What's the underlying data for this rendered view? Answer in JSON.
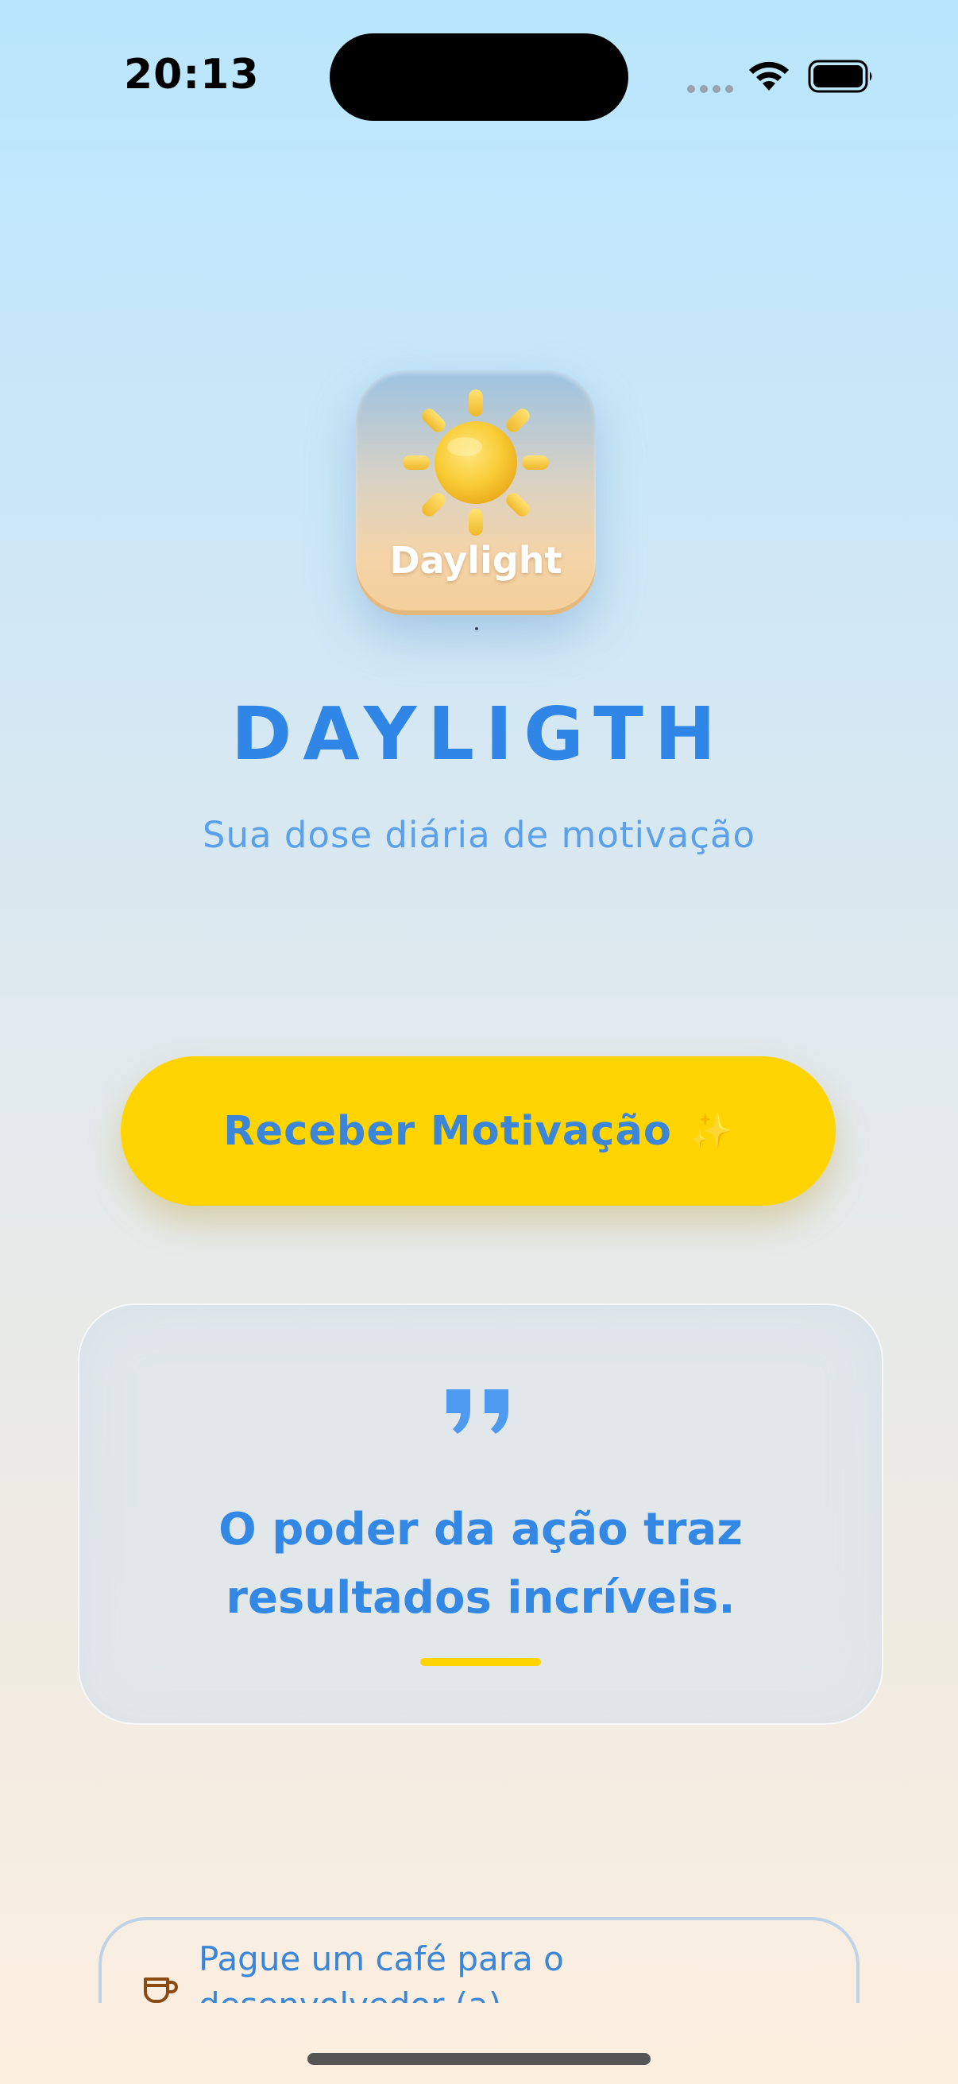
{
  "status_bar": {
    "time": "20:13",
    "icons": [
      "cellular-signal-icon",
      "wifi-icon",
      "battery-icon"
    ]
  },
  "app_icon": {
    "label": "Daylight",
    "icon": "sun-icon"
  },
  "header": {
    "title": "DAYLIGTH",
    "tagline": "Sua dose diária de motivação"
  },
  "motivation_button": {
    "label": "Receber Motivação",
    "emoji": "✨"
  },
  "quote_card": {
    "icon": "quote-icon",
    "text": "O poder da ação traz resultados incríveis."
  },
  "donate": {
    "icon": "coffee-cup-icon",
    "text": "Pague um café para o desenvolvedor (a)"
  },
  "colors": {
    "accent_blue": "#2f86e6",
    "accent_yellow": "#ffd400",
    "tagline_blue": "#5aa0ea"
  }
}
